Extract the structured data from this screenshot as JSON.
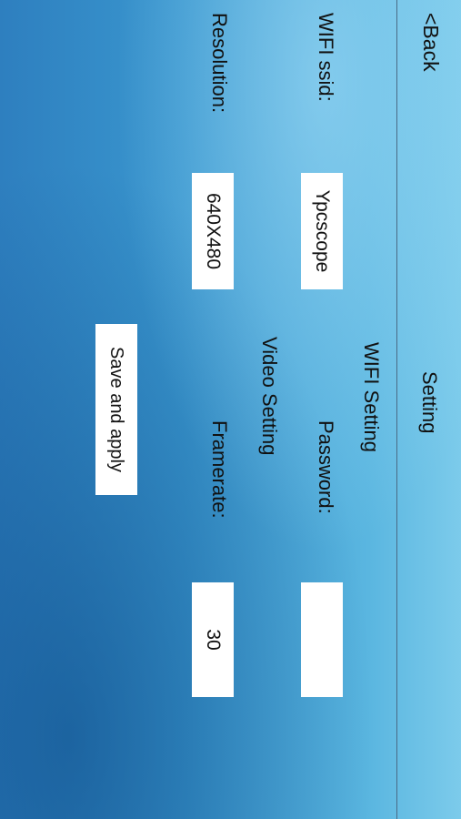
{
  "header": {
    "back_label": "<Back",
    "title": "Setting"
  },
  "wifi": {
    "section_title": "WIFI Setting",
    "ssid_label": "WIFI ssid:",
    "ssid_value": "Ypcscope",
    "password_label": "Password:",
    "password_value": ""
  },
  "video": {
    "section_title": "Video Setting",
    "resolution_label": "Resolution:",
    "resolution_value": "640X480",
    "framerate_label": "Framerate:",
    "framerate_value": "30"
  },
  "actions": {
    "save_label": "Save and apply"
  }
}
